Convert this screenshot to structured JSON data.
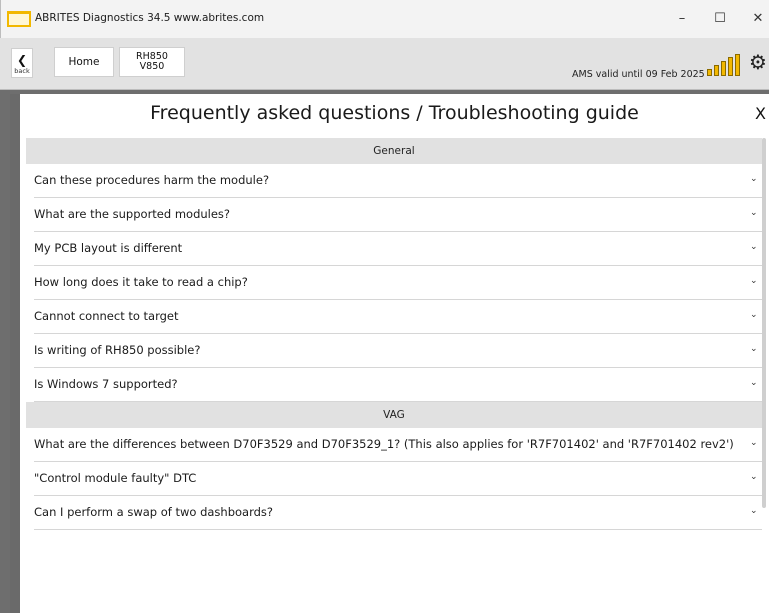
{
  "window": {
    "title": "ABRITES Diagnostics 34.5   www.abrites.com",
    "minimize_icon": "–",
    "maximize_icon": "☐",
    "close_icon": "✕"
  },
  "toolbar": {
    "back_arrow": "❮",
    "back_label": "back",
    "home_label": "Home",
    "chip_line1": "RH850",
    "chip_line2": "V850",
    "ams_status": "AMS valid until 09 Feb 2025",
    "signal_level": 5,
    "settings_icon": "⚙"
  },
  "colors": {
    "accent": "#f2b800",
    "section_bg": "#e1e1e1",
    "frame": "#6e6e6e"
  },
  "faq": {
    "title": "Frequently asked questions / Troubleshooting guide",
    "close_label": "X",
    "sections": [
      {
        "name": "General",
        "items": [
          "Can these procedures harm the module?",
          "What are the supported modules?",
          "My PCB layout is different",
          "How long does it take to read a chip?",
          "Cannot connect to target",
          "Is writing of RH850 possible?",
          "Is Windows 7 supported?"
        ]
      },
      {
        "name": "VAG",
        "items": [
          "What are the differences between D70F3529 and D70F3529_1? (This also applies for 'R7F701402' and 'R7F701402 rev2')",
          "\"Control module faulty\" DTC",
          "Can I perform a swap of two dashboards?"
        ]
      }
    ],
    "chevron": "⌄"
  }
}
